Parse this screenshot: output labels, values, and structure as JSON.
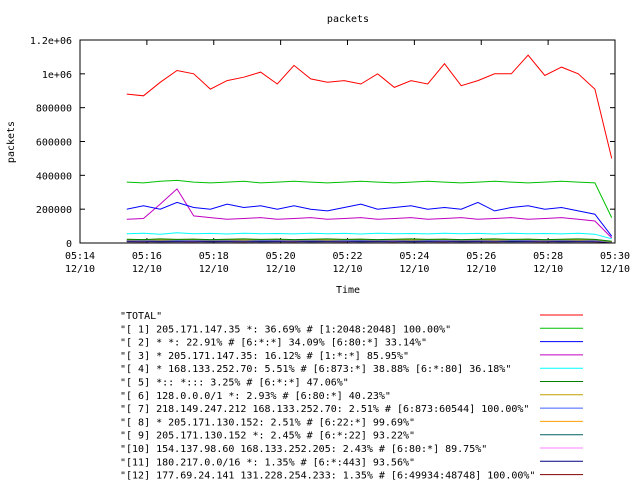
{
  "chart_data": {
    "type": "line",
    "title": "packets",
    "xlabel": "Time",
    "ylabel": "packets",
    "ylim": [
      0,
      1200000
    ],
    "xlim": [
      "2000-12-10 05:14",
      "2000-12-10 05:30"
    ],
    "grid": false,
    "legend_placement": "bottom",
    "y_ticks": [
      {
        "value": 0,
        "label": "0"
      },
      {
        "value": 200000,
        "label": "200000"
      },
      {
        "value": 400000,
        "label": "400000"
      },
      {
        "value": 600000,
        "label": "600000"
      },
      {
        "value": 800000,
        "label": "800000"
      },
      {
        "value": 1000000,
        "label": "1e+06"
      },
      {
        "value": 1200000,
        "label": "1.2e+06"
      }
    ],
    "x_ticks": [
      {
        "value": "05:14",
        "line1": "05:14",
        "line2": "12/10"
      },
      {
        "value": "05:16",
        "line1": "05:16",
        "line2": "12/10"
      },
      {
        "value": "05:18",
        "line1": "05:18",
        "line2": "12/10"
      },
      {
        "value": "05:20",
        "line1": "05:20",
        "line2": "12/10"
      },
      {
        "value": "05:22",
        "line1": "05:22",
        "line2": "12/10"
      },
      {
        "value": "05:24",
        "line1": "05:24",
        "line2": "12/10"
      },
      {
        "value": "05:26",
        "line1": "05:26",
        "line2": "12/10"
      },
      {
        "value": "05:28",
        "line1": "05:28",
        "line2": "12/10"
      },
      {
        "value": "05:30",
        "line1": "05:30",
        "line2": "12/10"
      }
    ],
    "x": [
      "05:15:24",
      "05:15:54",
      "05:16:24",
      "05:16:54",
      "05:17:24",
      "05:17:54",
      "05:18:24",
      "05:18:54",
      "05:19:24",
      "05:19:54",
      "05:20:24",
      "05:20:54",
      "05:21:24",
      "05:21:54",
      "05:22:24",
      "05:22:54",
      "05:23:24",
      "05:23:54",
      "05:24:24",
      "05:24:54",
      "05:25:24",
      "05:25:54",
      "05:26:24",
      "05:26:54",
      "05:27:24",
      "05:27:54",
      "05:28:24",
      "05:28:54",
      "05:29:24",
      "05:29:54"
    ],
    "series": [
      {
        "name": "\"TOTAL\"",
        "color": "#ff0000",
        "values": [
          880000,
          870000,
          950000,
          1020000,
          1000000,
          910000,
          960000,
          980000,
          1010000,
          940000,
          1050000,
          970000,
          950000,
          960000,
          940000,
          1000000,
          920000,
          960000,
          940000,
          1060000,
          930000,
          960000,
          1000000,
          1000000,
          1110000,
          990000,
          1040000,
          1000000,
          910000,
          500000
        ]
      },
      {
        "name": "\"[ 1] 205.171.147.35 *: 36.69% # [1:2048:2048] 100.00%\"",
        "color": "#00c000",
        "values": [
          360000,
          355000,
          365000,
          370000,
          360000,
          355000,
          360000,
          365000,
          355000,
          360000,
          365000,
          360000,
          355000,
          360000,
          365000,
          360000,
          355000,
          360000,
          365000,
          360000,
          355000,
          360000,
          365000,
          360000,
          355000,
          360000,
          365000,
          360000,
          355000,
          150000
        ]
      },
      {
        "name": "\"[ 2] * *: 22.91% # [6:*:*] 34.09% [6:80:*] 33.14%\"",
        "color": "#0000ff",
        "values": [
          200000,
          220000,
          200000,
          240000,
          210000,
          200000,
          230000,
          210000,
          220000,
          200000,
          220000,
          200000,
          190000,
          210000,
          230000,
          200000,
          210000,
          220000,
          200000,
          210000,
          200000,
          240000,
          190000,
          210000,
          220000,
          200000,
          210000,
          190000,
          170000,
          40000
        ]
      },
      {
        "name": "\"[ 3] * 205.171.147.35: 16.12% # [1:*:*] 85.95%\"",
        "color": "#c000c0",
        "values": [
          140000,
          145000,
          230000,
          320000,
          160000,
          150000,
          140000,
          145000,
          150000,
          140000,
          145000,
          150000,
          140000,
          145000,
          150000,
          140000,
          145000,
          150000,
          140000,
          145000,
          150000,
          140000,
          145000,
          150000,
          140000,
          145000,
          150000,
          140000,
          130000,
          30000
        ]
      },
      {
        "name": "\"[ 4] * 168.133.252.70: 5.51% # [6:873:*] 38.88% [6:*:80] 36.18%\"",
        "color": "#00ffff",
        "values": [
          55000,
          58000,
          52000,
          60000,
          55000,
          57000,
          53000,
          58000,
          55000,
          56000,
          54000,
          58000,
          55000,
          57000,
          53000,
          58000,
          55000,
          56000,
          54000,
          58000,
          55000,
          57000,
          53000,
          58000,
          55000,
          56000,
          54000,
          58000,
          52000,
          25000
        ]
      },
      {
        "name": "\"[ 5] *:: *::: 3.25% # [6:*:*] 47.06%\"",
        "color": "#008000",
        "values": [
          22000,
          20000,
          24000,
          21000,
          23000,
          20000,
          22000,
          24000,
          21000,
          23000,
          20000,
          22000,
          24000,
          21000,
          23000,
          20000,
          22000,
          24000,
          21000,
          23000,
          20000,
          22000,
          24000,
          21000,
          23000,
          20000,
          22000,
          24000,
          21000,
          10000
        ]
      },
      {
        "name": "\"[ 6] 128.0.0.0/1 *: 2.93% # [6:80:*] 40.23%\"",
        "color": "#c0a000",
        "values": [
          18000,
          20000,
          17000,
          19000,
          21000,
          18000,
          20000,
          17000,
          19000,
          21000,
          18000,
          20000,
          17000,
          19000,
          21000,
          18000,
          20000,
          17000,
          19000,
          21000,
          18000,
          20000,
          17000,
          19000,
          21000,
          18000,
          20000,
          17000,
          19000,
          8000
        ]
      },
      {
        "name": "\"[ 7] 218.149.247.212 168.133.252.70: 2.51% # [6:873:60544] 100.00%\"",
        "color": "#4060ff",
        "values": [
          15000,
          16000,
          14000,
          15000,
          17000,
          15000,
          16000,
          14000,
          15000,
          17000,
          15000,
          16000,
          14000,
          15000,
          17000,
          15000,
          16000,
          14000,
          15000,
          17000,
          15000,
          16000,
          14000,
          15000,
          17000,
          15000,
          16000,
          14000,
          15000,
          7000
        ]
      },
      {
        "name": "\"[ 8] * 205.171.130.152: 2.51% # [6:22:*] 99.69%\"",
        "color": "#ffa000",
        "values": [
          15000,
          14000,
          16000,
          15000,
          14000,
          16000,
          15000,
          14000,
          16000,
          15000,
          14000,
          16000,
          15000,
          14000,
          16000,
          15000,
          14000,
          16000,
          15000,
          14000,
          16000,
          15000,
          14000,
          16000,
          15000,
          14000,
          16000,
          15000,
          14000,
          7000
        ]
      },
      {
        "name": "\"[ 9] 205.171.130.152 *: 2.45% # [6:*:22] 93.22%\"",
        "color": "#006060",
        "values": [
          14000,
          15000,
          13000,
          14000,
          15000,
          13000,
          14000,
          15000,
          13000,
          14000,
          15000,
          13000,
          14000,
          15000,
          13000,
          14000,
          15000,
          13000,
          14000,
          15000,
          13000,
          14000,
          15000,
          13000,
          14000,
          15000,
          13000,
          14000,
          15000,
          6000
        ]
      },
      {
        "name": "\"[10] 154.137.98.60 168.133.252.205: 2.43% # [6:80:*] 89.75%\"",
        "color": "#ff80ff",
        "values": [
          14000,
          13000,
          15000,
          14000,
          13000,
          15000,
          14000,
          13000,
          15000,
          14000,
          13000,
          15000,
          14000,
          13000,
          15000,
          14000,
          13000,
          15000,
          14000,
          13000,
          15000,
          14000,
          13000,
          15000,
          14000,
          13000,
          15000,
          14000,
          13000,
          6000
        ]
      },
      {
        "name": "\"[11] 180.217.0.0/16 *: 1.35% # [6:*:443] 93.56%\"",
        "color": "#000080",
        "values": [
          8000,
          9000,
          7000,
          8000,
          9000,
          7000,
          8000,
          9000,
          7000,
          8000,
          9000,
          7000,
          8000,
          9000,
          7000,
          8000,
          9000,
          7000,
          8000,
          9000,
          7000,
          8000,
          9000,
          7000,
          8000,
          9000,
          7000,
          8000,
          9000,
          4000
        ]
      },
      {
        "name": "\"[12] 177.69.24.141 131.228.254.233: 1.35% # [6:49934:48748] 100.00%\"",
        "color": "#800000",
        "values": [
          8000,
          7000,
          9000,
          8000,
          7000,
          9000,
          8000,
          7000,
          9000,
          8000,
          7000,
          9000,
          8000,
          7000,
          9000,
          8000,
          7000,
          9000,
          8000,
          7000,
          9000,
          8000,
          7000,
          9000,
          8000,
          7000,
          9000,
          8000,
          7000,
          4000
        ]
      }
    ]
  }
}
